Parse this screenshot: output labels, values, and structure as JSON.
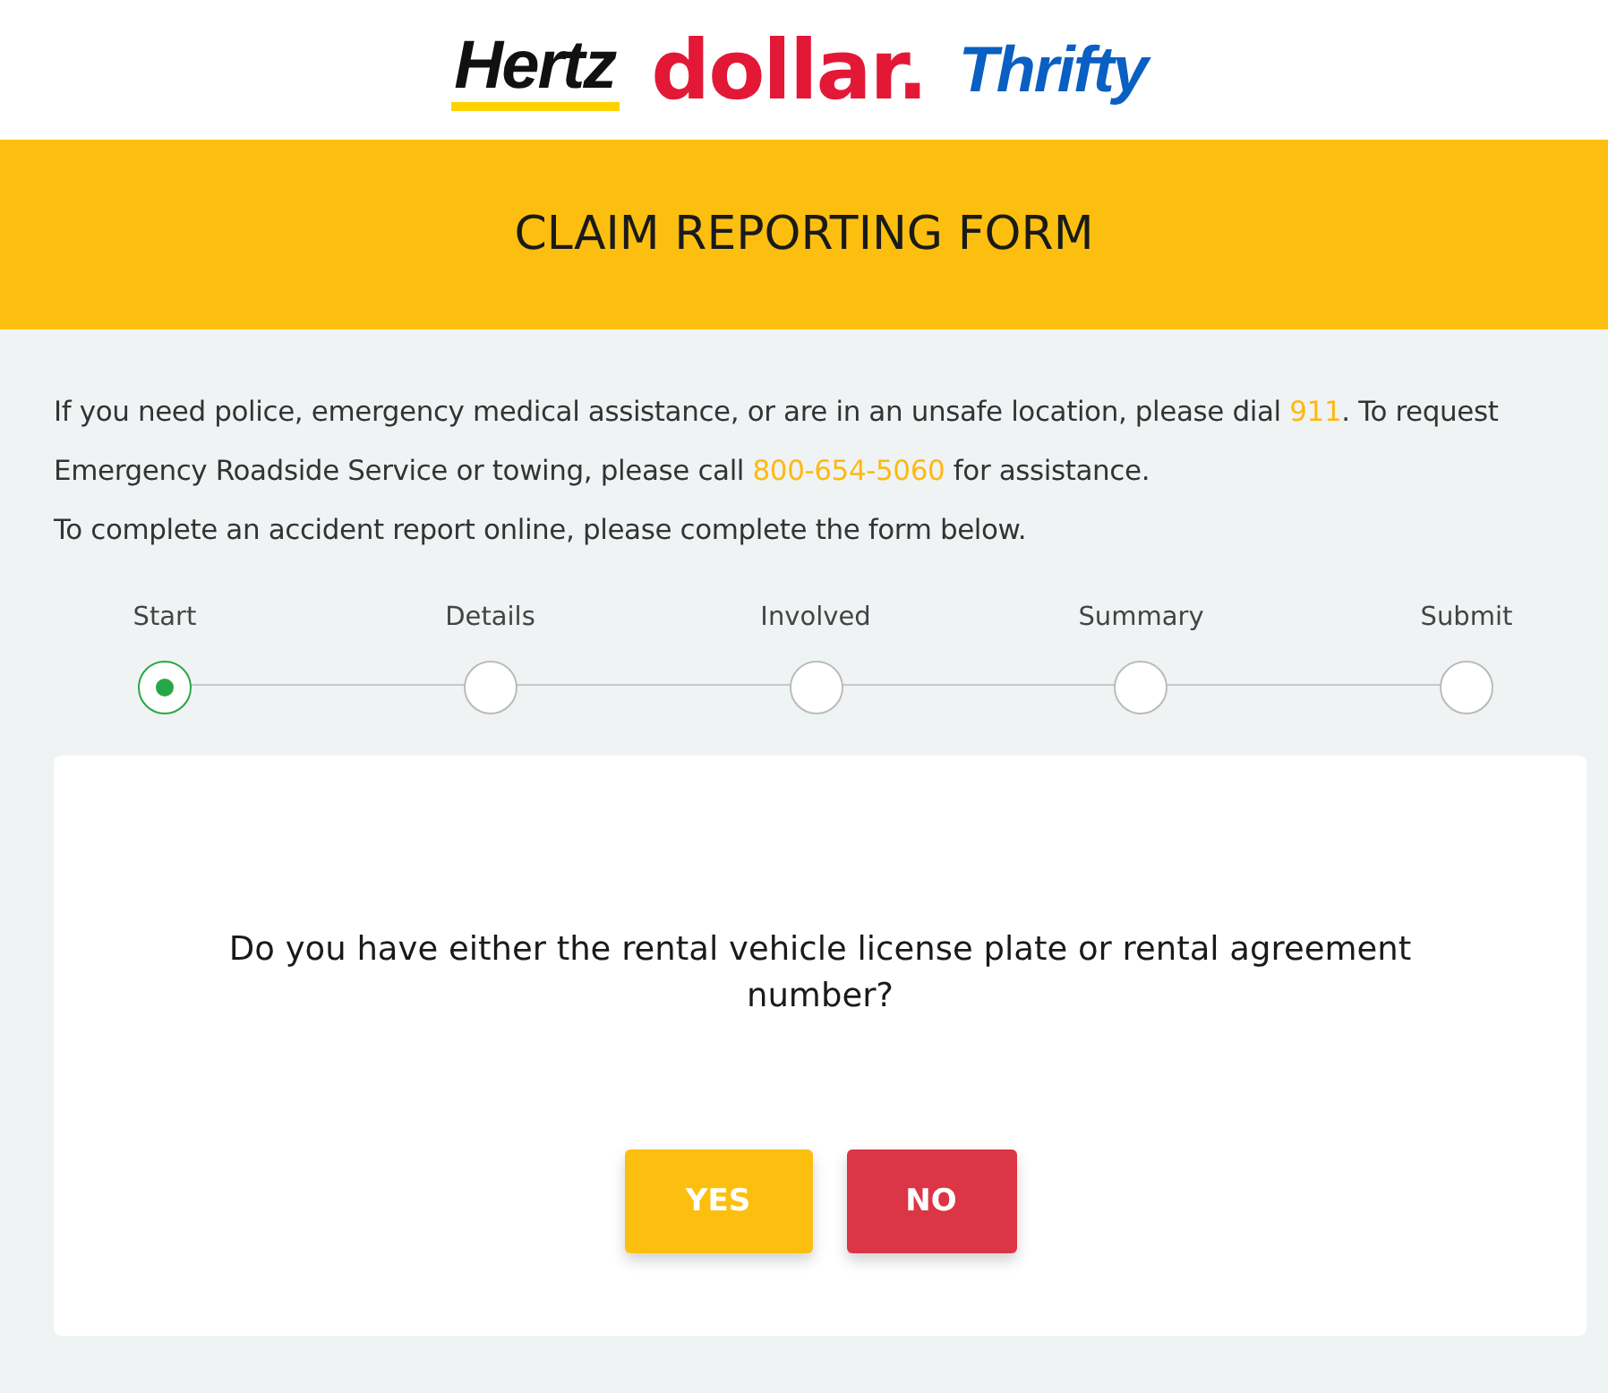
{
  "brands": [
    {
      "kind": "hertz",
      "name": "Hertz"
    },
    {
      "kind": "dollar",
      "name": "dollar."
    },
    {
      "kind": "thrifty",
      "name": "Thrifty"
    }
  ],
  "banner": {
    "title": "CLAIM REPORTING FORM"
  },
  "intro": [
    {
      "parts": [
        {
          "kind": "text",
          "text": "If you need police, emergency medical assistance, or are in an unsafe location, please dial "
        },
        {
          "kind": "link",
          "text": "911"
        },
        {
          "kind": "text",
          "text": ". To request Emergency Roadside Service or towing, please call "
        },
        {
          "kind": "link",
          "text": "800-654-5060"
        },
        {
          "kind": "text",
          "text": " for assistance."
        }
      ]
    },
    {
      "parts": [
        {
          "kind": "text",
          "text": "To complete an accident report online, please complete the form below."
        }
      ]
    }
  ],
  "steps": [
    {
      "label": "Start",
      "selected": true
    },
    {
      "label": "Details",
      "selected": false
    },
    {
      "label": "Involved",
      "selected": false
    },
    {
      "label": "Summary",
      "selected": false
    },
    {
      "label": "Submit",
      "selected": false
    }
  ],
  "question": {
    "text": "Do you have either the rental vehicle license plate or rental agreement number?",
    "buttons": [
      {
        "kind": "yes",
        "label": "YES"
      },
      {
        "kind": "no",
        "label": "NO"
      }
    ]
  }
}
